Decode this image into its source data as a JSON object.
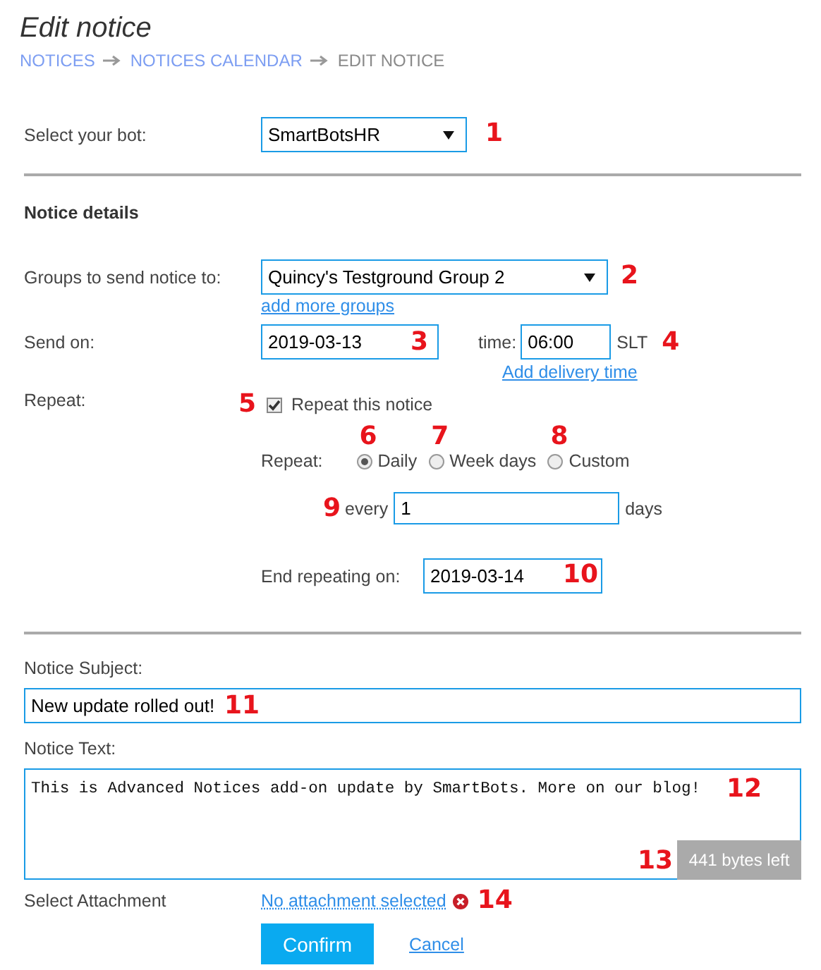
{
  "page": {
    "title": "Edit notice",
    "breadcrumb": [
      {
        "label": "NOTICES",
        "link": true
      },
      {
        "label": "NOTICES CALENDAR",
        "link": true
      },
      {
        "label": "EDIT NOTICE",
        "link": false
      }
    ]
  },
  "bot": {
    "label": "Select your bot:",
    "value": "SmartBotsHR",
    "callout": "1"
  },
  "notice_details": {
    "heading": "Notice details",
    "groups": {
      "label": "Groups to send notice to:",
      "value": "Quincy's Testground Group 2",
      "callout": "2",
      "link": "add more groups"
    },
    "send_on": {
      "label": "Send on:",
      "date": "2019-03-13",
      "date_callout": "3",
      "time_label": "time:",
      "time": "06:00",
      "time_unit": "SLT",
      "time_callout": "4",
      "link": "Add delivery time"
    },
    "repeat": {
      "label": "Repeat:",
      "callout": "5",
      "checkbox_label": "Repeat this notice",
      "checked": true,
      "mode_label": "Repeat:",
      "modes": [
        {
          "label": "Daily",
          "selected": true,
          "callout": "6"
        },
        {
          "label": "Week days",
          "selected": false,
          "callout": "7"
        },
        {
          "label": "Custom",
          "selected": false,
          "callout": "8"
        }
      ],
      "every_callout": "9",
      "every_label": "every",
      "every_value": "1",
      "every_unit": "days",
      "end_label": "End repeating on:",
      "end_value": "2019-03-14",
      "end_callout": "10"
    }
  },
  "message": {
    "subject_label": "Notice Subject:",
    "subject": "New update rolled out!",
    "subject_callout": "11",
    "text_label": "Notice Text:",
    "text": "This is Advanced Notices add-on update by SmartBots. More on our blog!",
    "text_callout": "12",
    "bytes_left": "441 bytes left",
    "bytes_callout": "13"
  },
  "attachment": {
    "label": "Select Attachment",
    "link": "No attachment selected",
    "callout": "14"
  },
  "actions": {
    "confirm": "Confirm",
    "cancel": "Cancel"
  }
}
